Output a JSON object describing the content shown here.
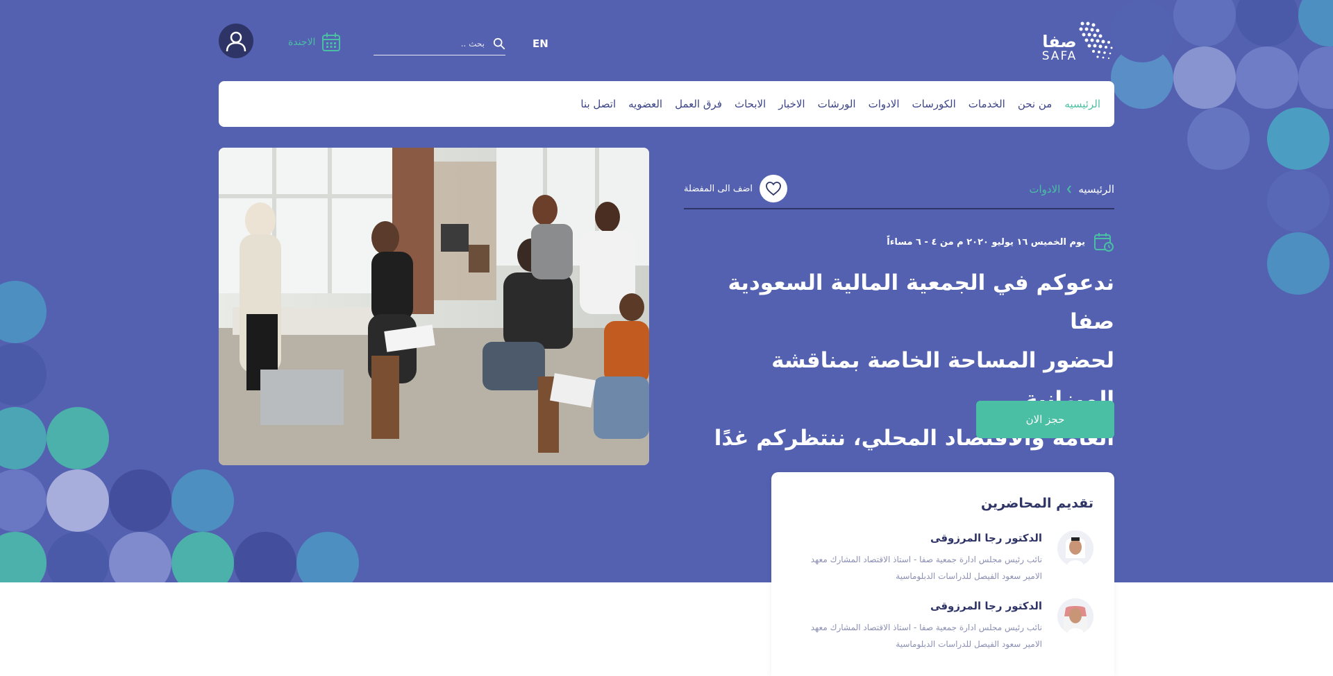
{
  "header": {
    "logo_ar": "صفا",
    "logo_en": "SAFA",
    "lang_label": "EN",
    "search_placeholder": "بحث ..",
    "agenda_label": "الاجندة"
  },
  "nav": {
    "items": [
      {
        "label": "الرئيسيه",
        "active": true
      },
      {
        "label": "من نحن"
      },
      {
        "label": "الخدمات"
      },
      {
        "label": "الكورسات"
      },
      {
        "label": "الادوات"
      },
      {
        "label": "الورشات"
      },
      {
        "label": "الاخبار"
      },
      {
        "label": "الابحاث"
      },
      {
        "label": "فرق العمل"
      },
      {
        "label": "العضويه"
      },
      {
        "label": "اتصل بنا"
      }
    ]
  },
  "breadcrumb": {
    "home": "الرئيسيه",
    "current": "الادوات"
  },
  "favorite_label": "اضف الى المفضلة",
  "event": {
    "date": "يوم الخميس ١٦ يوليو ٢٠٢٠ م من ٤ - ٦ مساءاً",
    "title_lines": [
      "ندعوكم في الجمعية المالية السعودية صفا",
      "لحضور المساحة الخاصة بمناقشة الميزانية",
      "العامة والاقتصاد المحلي، ننتظركم غدًا"
    ],
    "book_label": "حجز الان"
  },
  "speakers": {
    "title": "تقديم المحاضرين",
    "items": [
      {
        "name": "الدكتور رجا المرزوقى",
        "bio": "نائب رئيس مجلس ادارة جمعية صفا - استاذ الاقتصاد المشارك معهد الامير سعود الفيصل للدراسات الدبلوماسية"
      },
      {
        "name": "الدكتور رجا المرزوقى",
        "bio": "نائب رئيس مجلس ادارة جمعية صفا - استاذ الاقتصاد المشارك معهد الامير سعود الفيصل للدراسات الدبلوماسية"
      }
    ]
  },
  "colors": {
    "hero_bg": "#5361b0",
    "accent": "#4bbfa4",
    "navy": "#2f3467"
  },
  "icons": [
    "safa-logo",
    "search-icon",
    "calendar-icon",
    "user-icon",
    "heart-icon",
    "chevron-left-icon",
    "calendar-clock-icon"
  ]
}
